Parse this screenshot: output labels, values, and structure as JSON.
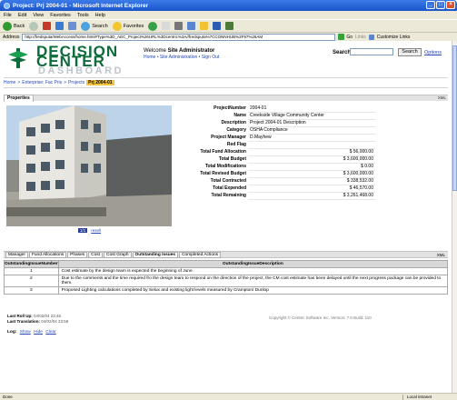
{
  "window": {
    "title": "Project: Prj 2004-01 - Microsoft Internet Explorer"
  },
  "menu": [
    "File",
    "Edit",
    "View",
    "Favorites",
    "Tools",
    "Help"
  ],
  "toolbar": {
    "back": "Back",
    "search": "Search",
    "favorites": "Favorites"
  },
  "address": {
    "label": "Address",
    "url": "http://fredsputa/WebAccess/home.html#Type%3D_AEC_Project%26URL%3Dcentric%3A//fredsputa%7CCONNHUB%2F97%26AM",
    "go": "Go",
    "links_label": "Links",
    "customize": "Customize Links"
  },
  "header": {
    "logo_line1": "DECISION",
    "logo_line2": "CENTER",
    "logo_line3": "DASHBOARD",
    "welcome_prefix": "Welcome",
    "user": "Site Administrator",
    "links": "Home  •  Site Administration  •  Sign Out",
    "search_label": "Search:",
    "search_value": "",
    "search_button": "Search",
    "options": "Options"
  },
  "breadcrumb": {
    "items": [
      "Home",
      ">",
      "Enterprise: Fac Pris",
      ">",
      "Projects"
    ],
    "current": "Prj 2004-01"
  },
  "properties": {
    "tab_label": "Properties",
    "xml": "XML",
    "rows": [
      {
        "key": "ProjectNumber",
        "value": "2004-01",
        "num": false
      },
      {
        "key": "Name",
        "value": "Creekside Village Community Center",
        "num": false
      },
      {
        "key": "Description",
        "value": "Project 2004-01 Description",
        "num": false
      },
      {
        "key": "Category",
        "value": "OSHA Compliance",
        "num": false
      },
      {
        "key": "Project Manager",
        "value": "D.Mayhew",
        "num": false
      },
      {
        "key": "Red Flag",
        "value": "",
        "num": false
      },
      {
        "key": "Total Fund Allocation",
        "value": "$ 56,000.00",
        "num": true
      },
      {
        "key": "Total Budget",
        "value": "$ 3,600,000.00",
        "num": true
      },
      {
        "key": "Total Modifications",
        "value": "$ 0.00",
        "num": true
      },
      {
        "key": "Total Revised Budget",
        "value": "$ 3,600,000.00",
        "num": true
      },
      {
        "key": "Total Contracted",
        "value": "$ 338,532.00",
        "num": true
      },
      {
        "key": "Total Expended",
        "value": "$ 46,570.00",
        "num": true
      },
      {
        "key": "Total Remaining",
        "value": "$ 3,261,468.00",
        "num": true
      }
    ],
    "photo_link_1": "1/1",
    "photo_link_2": "resell"
  },
  "tabs": {
    "items": [
      {
        "label": "Manager",
        "active": false
      },
      {
        "label": "Fund Allocations",
        "active": false
      },
      {
        "label": "Phases",
        "active": false
      },
      {
        "label": "Cost",
        "active": false
      },
      {
        "label": "Cost Graph",
        "active": false
      },
      {
        "label": "Outstanding Issues",
        "active": true
      },
      {
        "label": "Completed Actions",
        "active": false
      }
    ],
    "xml": "XML"
  },
  "issues": {
    "columns": [
      "OutstandingIssueNumber",
      "OutstandingIssueDescription"
    ],
    "rows": [
      [
        "1",
        "Cost estimate by the design team is expected the beginning of June."
      ],
      [
        "2",
        "Due to the comments and the time required fro the design team to respond on the direction of the project, the CM cost estimate has been delayed until the next progress package can be provided to them."
      ],
      [
        "3",
        "Proposed Lighting calculations completed by Selux and existing light levels measured by Crampton/ Dunlop"
      ]
    ]
  },
  "footer": {
    "last_roll_label": "Last Roll Up:",
    "last_roll_value": "04/02/04 23:46",
    "last_trans_label": "Last Translation:",
    "last_trans_value": "04/02/04 23:56",
    "copyright": "Copyright © Centric Software Inc.   Version: 7.0   Build: 110"
  },
  "log": {
    "label": "Log:",
    "show": "Show",
    "hide": "Hide",
    "clear": "Clear"
  },
  "status": {
    "text": "Done",
    "zone": "Local intranet"
  },
  "colors": {
    "titlebar": "#1a55c9",
    "logo_green": "#0e6b3a",
    "link": "#2446b8",
    "breadcrumb_current": "#f5c542"
  }
}
